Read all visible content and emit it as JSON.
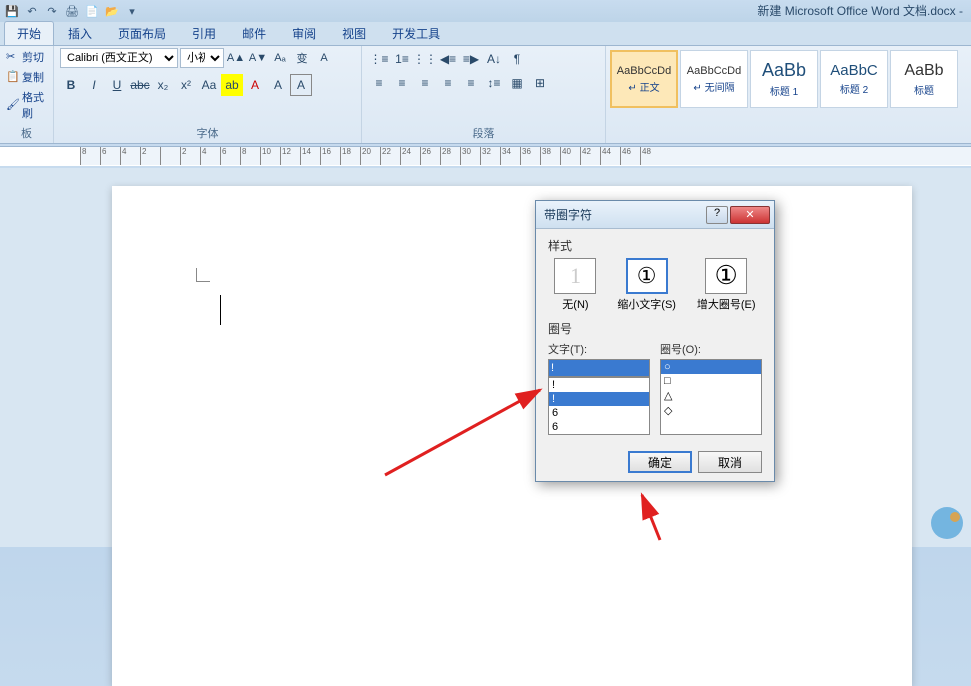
{
  "window": {
    "title": "新建 Microsoft Office Word 文档.docx -"
  },
  "qat": {
    "icons": [
      "save",
      "undo",
      "redo",
      "print",
      "preview",
      "open",
      "new"
    ]
  },
  "tabs": {
    "items": [
      "开始",
      "插入",
      "页面布局",
      "引用",
      "邮件",
      "审阅",
      "视图",
      "开发工具"
    ],
    "active": 0
  },
  "ribbon": {
    "clipboard": {
      "label": "板",
      "cut": "剪切",
      "copy": "复制",
      "format_painter": "格式刷"
    },
    "font": {
      "label": "字体",
      "font_name": "Calibri (西文正文)",
      "font_size": "小初",
      "buttons_r1": [
        "A▲",
        "A▼",
        "Aₐ",
        "变",
        "A"
      ],
      "buttons_r2": [
        "B",
        "I",
        "U",
        "abc",
        "x₂",
        "x²",
        "Aa",
        "ab",
        "A",
        "A",
        "A"
      ]
    },
    "paragraph": {
      "label": "段落"
    },
    "styles": [
      {
        "preview": "AaBbCcDd",
        "name": "↵ 正文",
        "active": true
      },
      {
        "preview": "AaBbCcDd",
        "name": "↵ 无间隔",
        "active": false
      },
      {
        "preview": "AaBb",
        "name": "标题 1",
        "active": false
      },
      {
        "preview": "AaBbC",
        "name": "标题 2",
        "active": false
      },
      {
        "preview": "AaBb",
        "name": "标题",
        "active": false
      }
    ]
  },
  "ruler": {
    "marks": [
      "8",
      "6",
      "4",
      "2",
      "",
      "2",
      "4",
      "6",
      "8",
      "10",
      "12",
      "14",
      "16",
      "18",
      "20",
      "22",
      "24",
      "26",
      "28",
      "30",
      "32",
      "34",
      "36",
      "38",
      "40",
      "42",
      "44",
      "46",
      "48"
    ]
  },
  "dialog": {
    "title": "带圈字符",
    "style_label": "样式",
    "style_options": [
      {
        "preview": "1",
        "label": "无(N)"
      },
      {
        "preview": "①",
        "label": "缩小文字(S)"
      },
      {
        "preview": "①",
        "label": "增大圈号(E)"
      }
    ],
    "selected_style": 1,
    "enclosure_label": "圈号",
    "text_label": "文字(T):",
    "text_value": "!",
    "text_list": [
      "!",
      "!",
      "6",
      "6"
    ],
    "text_selected": 1,
    "shape_label": "圈号(O):",
    "shape_list": [
      "○",
      "□",
      "△",
      "◇"
    ],
    "shape_selected": 0,
    "ok": "确定",
    "cancel": "取消"
  }
}
